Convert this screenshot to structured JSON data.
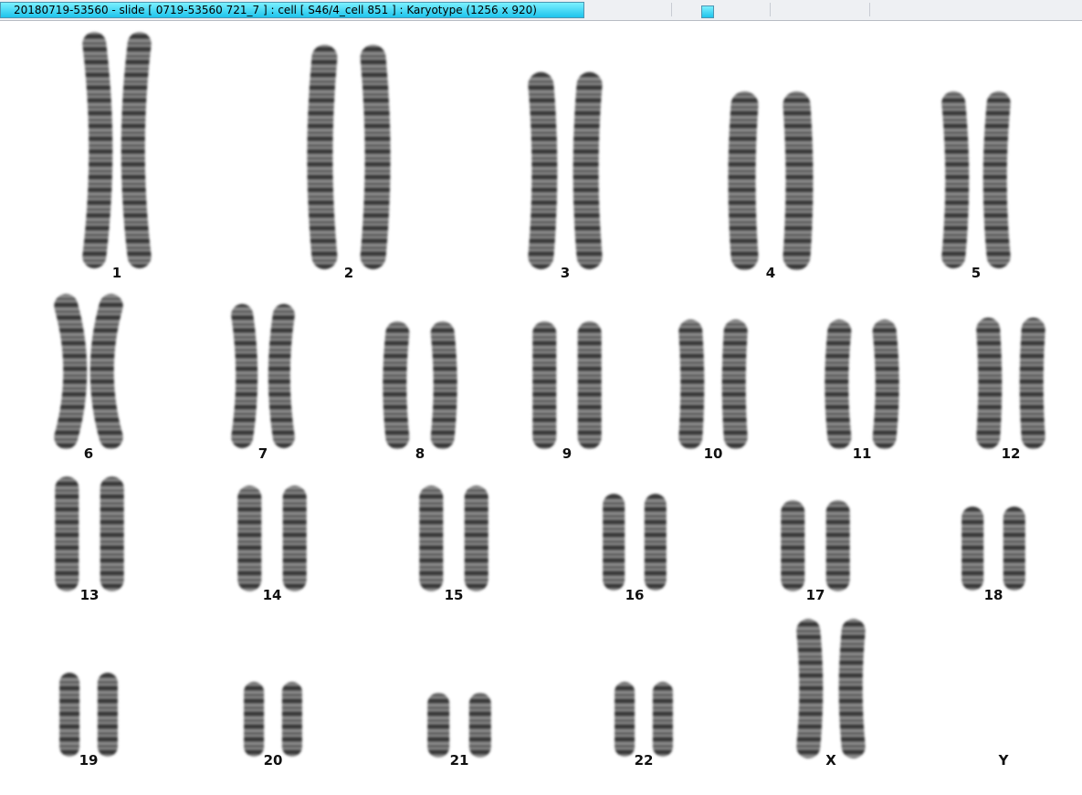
{
  "window": {
    "title": "20180719-53560 - slide [ 0719-53560 721_7 ] : cell [ S46/4_cell 851 ] : Karyotype  (1256 x 920)"
  },
  "karyotype": {
    "labels": {
      "c1": "1",
      "c2": "2",
      "c3": "3",
      "c4": "4",
      "c5": "5",
      "c6": "6",
      "c7": "7",
      "c8": "8",
      "c9": "9",
      "c10": "10",
      "c11": "11",
      "c12": "12",
      "c13": "13",
      "c14": "14",
      "c15": "15",
      "c16": "16",
      "c17": "17",
      "c18": "18",
      "c19": "19",
      "c20": "20",
      "c21": "21",
      "c22": "22",
      "cX": "X",
      "cY": "Y"
    }
  },
  "colors": {
    "title_bar_highlight": "#1ec4ec",
    "chromosome_stain": "#222222",
    "background": "#ffffff"
  }
}
